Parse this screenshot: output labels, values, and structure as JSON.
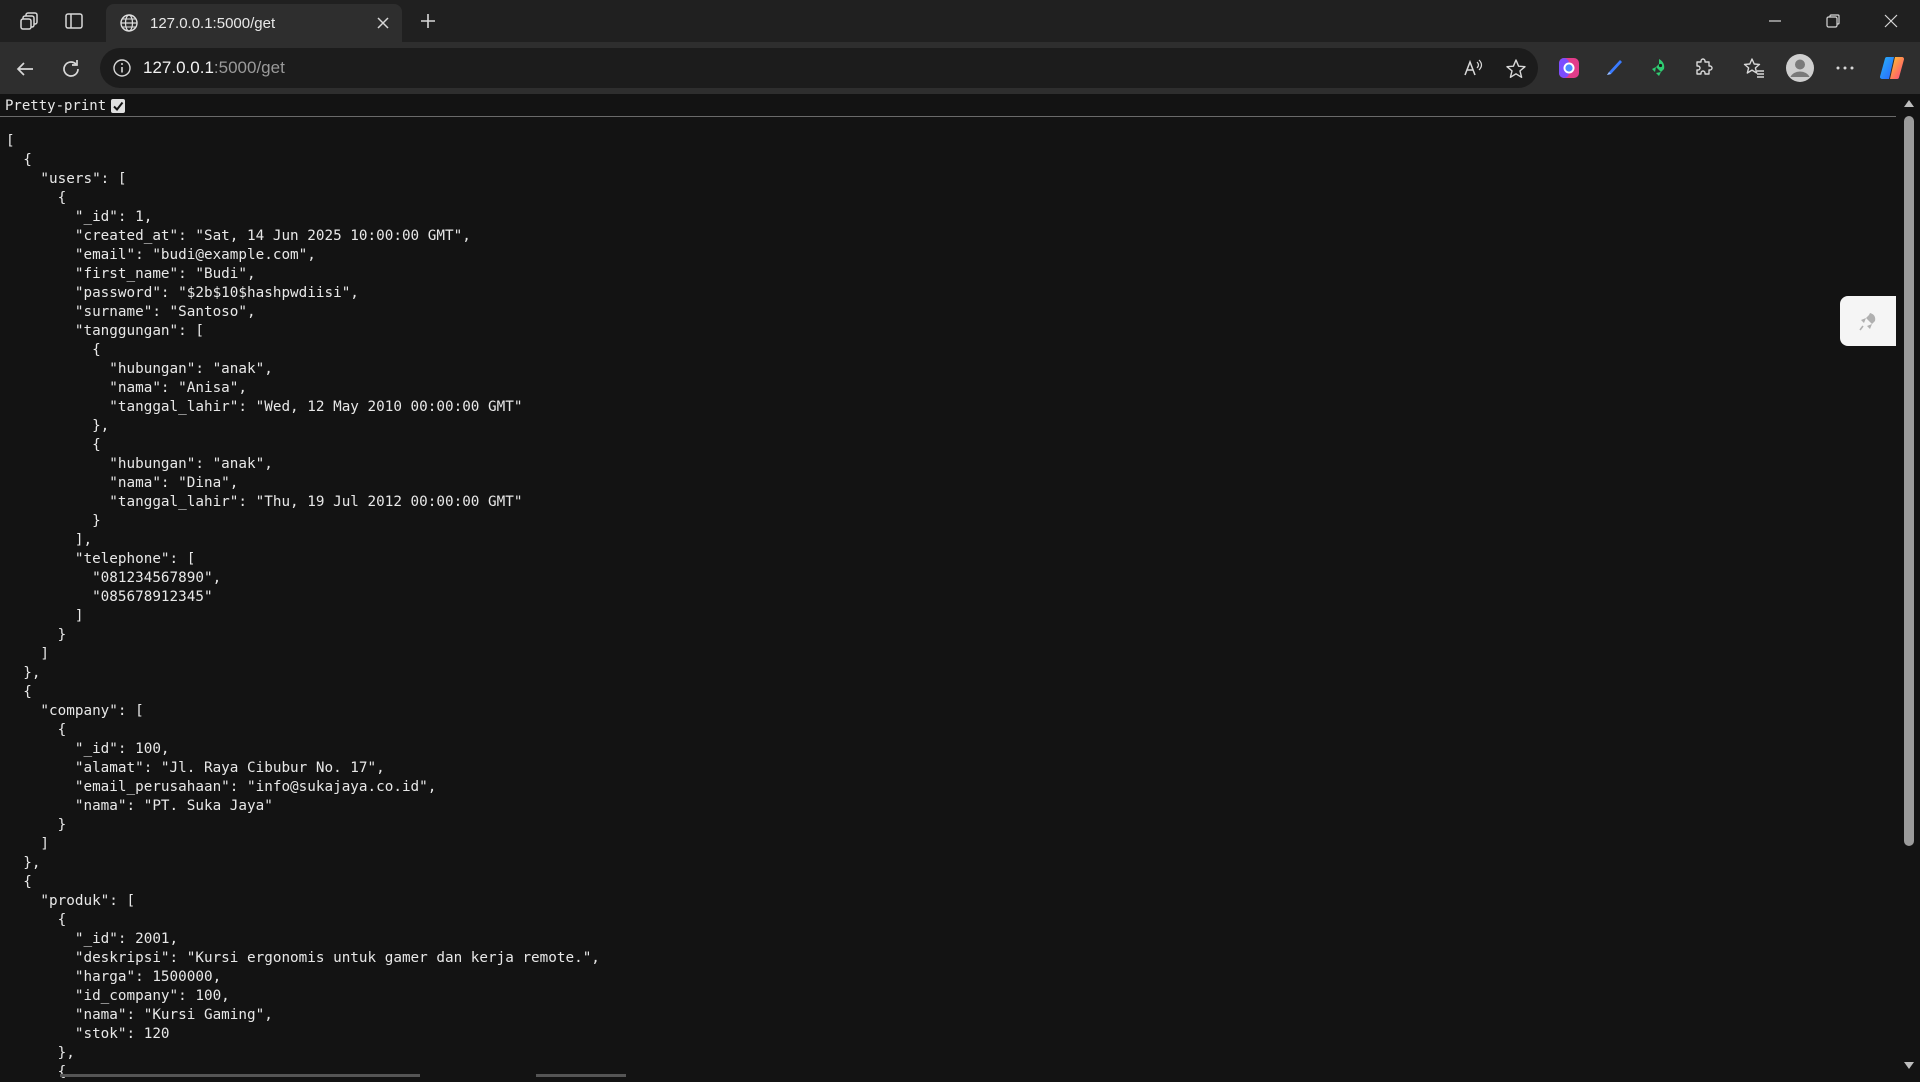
{
  "browser": {
    "tab": {
      "title": "127.0.0.1:5000/get"
    },
    "address": {
      "host": "127.0.0.1",
      "path": ":5000/get"
    }
  },
  "page": {
    "pretty_print_label": "Pretty-print",
    "pretty_print_checked": true,
    "json_text": "[\n  {\n    \"users\": [\n      {\n        \"_id\": 1,\n        \"created_at\": \"Sat, 14 Jun 2025 10:00:00 GMT\",\n        \"email\": \"budi@example.com\",\n        \"first_name\": \"Budi\",\n        \"password\": \"$2b$10$hashpwdiisi\",\n        \"surname\": \"Santoso\",\n        \"tanggungan\": [\n          {\n            \"hubungan\": \"anak\",\n            \"nama\": \"Anisa\",\n            \"tanggal_lahir\": \"Wed, 12 May 2010 00:00:00 GMT\"\n          },\n          {\n            \"hubungan\": \"anak\",\n            \"nama\": \"Dina\",\n            \"tanggal_lahir\": \"Thu, 19 Jul 2012 00:00:00 GMT\"\n          }\n        ],\n        \"telephone\": [\n          \"081234567890\",\n          \"085678912345\"\n        ]\n      }\n    ]\n  },\n  {\n    \"company\": [\n      {\n        \"_id\": 100,\n        \"alamat\": \"Jl. Raya Cibubur No. 17\",\n        \"email_perusahaan\": \"info@sukajaya.co.id\",\n        \"nama\": \"PT. Suka Jaya\"\n      }\n    ]\n  },\n  {\n    \"produk\": [\n      {\n        \"_id\": 2001,\n        \"deskripsi\": \"Kursi ergonomis untuk gamer dan kerja remote.\",\n        \"harga\": 1500000,\n        \"id_company\": 100,\n        \"nama\": \"Kursi Gaming\",\n        \"stok\": 120\n      },\n      {"
  },
  "icons": {
    "workspaces": "workspaces-icon",
    "tab_actions": "tab-actions-icon",
    "globe": "globe-icon",
    "close_tab": "close-icon",
    "new_tab": "plus-icon",
    "minimize": "minimize-icon",
    "restore": "restore-icon",
    "close_window": "close-icon",
    "back": "back-arrow-icon",
    "refresh": "refresh-icon",
    "site_info": "info-icon",
    "read_aloud": "read-aloud-icon",
    "favorite": "star-icon",
    "extensions": "puzzle-icon",
    "favorites": "favorites-icon",
    "profile": "profile-icon",
    "more": "more-icon",
    "copilot": "copilot-icon"
  },
  "colors": {
    "page_background": "#131313",
    "text": "#e8e8e8",
    "toolbar": "#2e2e2e"
  }
}
